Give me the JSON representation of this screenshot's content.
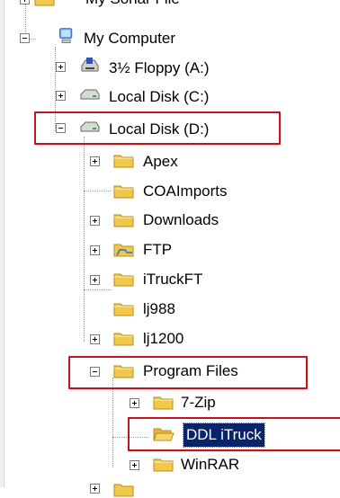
{
  "colors": {
    "highlight_box": "#c0141f",
    "selection_bg": "#0a246a",
    "folder": "#f0c94a",
    "tree_lines": "#9a9a9a"
  },
  "tree": {
    "top_partial": {
      "label": "My Sonar File",
      "icon": "folder-icon"
    },
    "my_computer": {
      "label": "My Computer",
      "icon": "computer-icon",
      "expanded": true
    },
    "floppy": {
      "label": "3½ Floppy (A:)",
      "icon": "floppy-drive-icon"
    },
    "disk_c": {
      "label": "Local Disk (C:)",
      "icon": "hard-disk-icon"
    },
    "disk_d": {
      "label": "Local Disk (D:)",
      "icon": "hard-disk-icon",
      "expanded": true,
      "children": [
        {
          "label": "Apex",
          "icon": "folder-icon"
        },
        {
          "label": "COAImports",
          "icon": "folder-icon"
        },
        {
          "label": "Downloads",
          "icon": "folder-icon"
        },
        {
          "label": "FTP",
          "icon": "shared-folder-icon"
        },
        {
          "label": "iTruckFT",
          "icon": "folder-icon"
        },
        {
          "label": "lj988",
          "icon": "folder-icon"
        },
        {
          "label": "lj1200",
          "icon": "folder-icon"
        }
      ]
    },
    "program_files": {
      "label": "Program Files",
      "icon": "folder-icon",
      "expanded": true,
      "children": [
        {
          "label": "7-Zip",
          "icon": "folder-icon"
        },
        {
          "label": "DDL iTruck",
          "icon": "open-folder-icon",
          "selected": true
        },
        {
          "label": "WinRAR",
          "icon": "folder-icon"
        }
      ]
    }
  }
}
